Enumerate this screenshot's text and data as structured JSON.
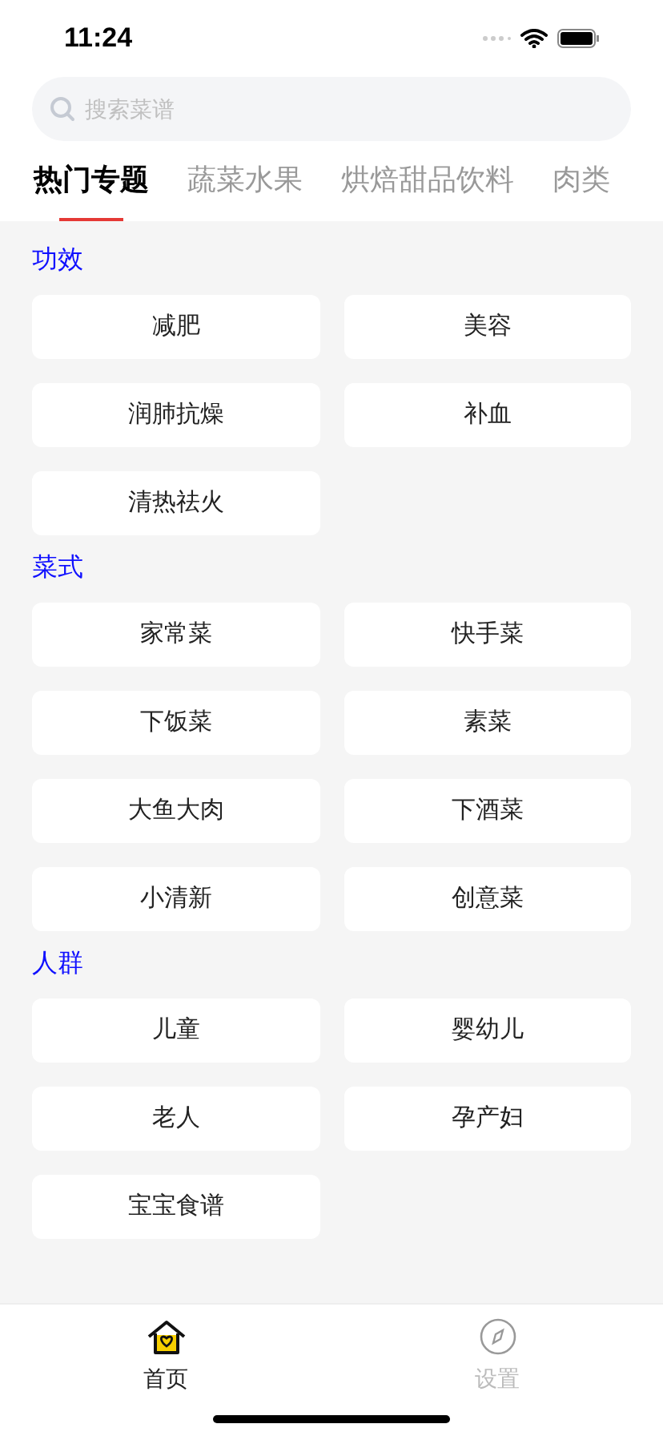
{
  "status_bar": {
    "time": "11:24"
  },
  "search": {
    "placeholder": "搜索菜谱"
  },
  "tabs": [
    {
      "label": "热门专题",
      "selected": true
    },
    {
      "label": "蔬菜水果",
      "selected": false
    },
    {
      "label": "烘焙甜品饮料",
      "selected": false
    },
    {
      "label": "肉类",
      "selected": false
    }
  ],
  "sections": [
    {
      "title": "功效",
      "items": [
        "减肥",
        "美容",
        "润肺抗燥",
        "补血",
        "清热祛火"
      ]
    },
    {
      "title": "菜式",
      "items": [
        "家常菜",
        "快手菜",
        "下饭菜",
        "素菜",
        "大鱼大肉",
        "下酒菜",
        "小清新",
        "创意菜"
      ]
    },
    {
      "title": "人群",
      "items": [
        "儿童",
        "婴幼儿",
        "老人",
        "孕产妇",
        "宝宝食谱"
      ]
    }
  ],
  "tab_bar": [
    {
      "label": "首页",
      "kind": "home",
      "selected": true
    },
    {
      "label": "设置",
      "kind": "compass",
      "selected": false
    }
  ]
}
